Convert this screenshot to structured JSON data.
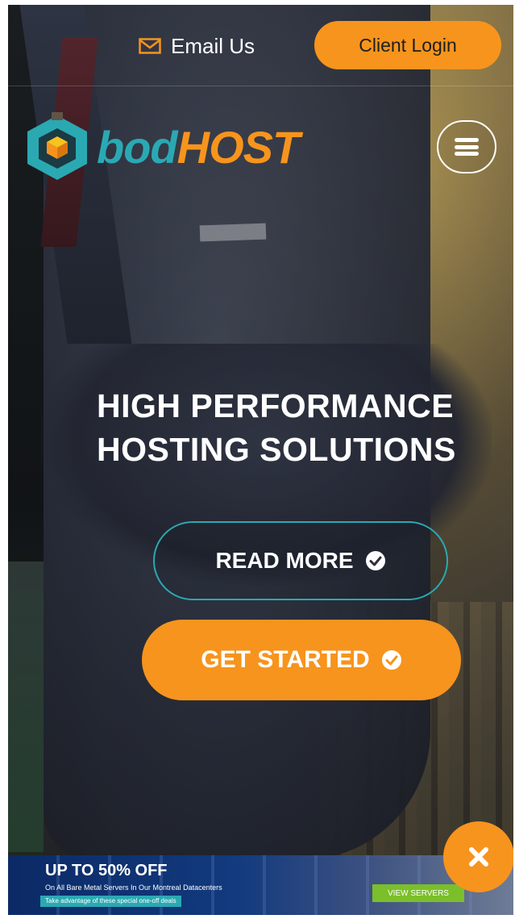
{
  "topbar": {
    "email_label": "Email Us",
    "client_login_label": "Client Login"
  },
  "brand": {
    "logo_part1": "bod",
    "logo_part2": "HOST",
    "colors": {
      "teal": "#2aa9b3",
      "orange": "#f7941d"
    }
  },
  "menu": {
    "icon": "hamburger-menu-icon"
  },
  "hero": {
    "title_line1": "HIGH PERFORMANCE",
    "title_line2": "HOSTING SOLUTIONS",
    "read_more_label": "READ MORE",
    "get_started_label": "GET STARTED"
  },
  "promo": {
    "title": "UP TO 50% OFF",
    "subtitle": "On All Bare Metal Servers In Our Montreal Datacenters",
    "note": "Take advantage of these special one-off deals",
    "button_label": "VIEW SERVERS",
    "close_icon": "close-icon"
  }
}
